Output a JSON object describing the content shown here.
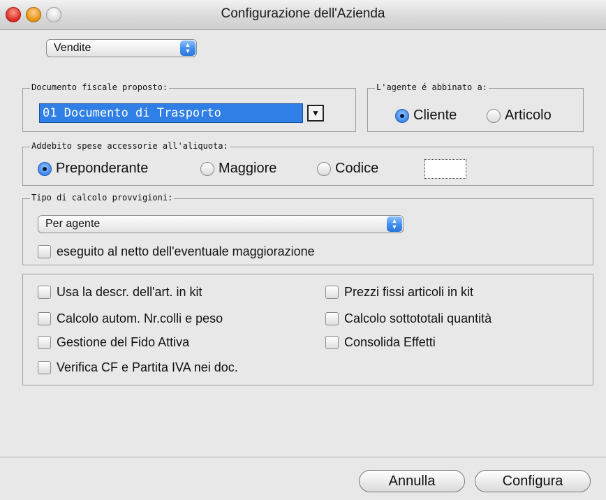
{
  "window": {
    "title": "Configurazione dell'Azienda"
  },
  "section_popup": {
    "value": "Vendite"
  },
  "documento": {
    "label": "Documento fiscale proposto:",
    "value": "01 Documento di Trasporto",
    "button_glyph": "▼"
  },
  "agente": {
    "label": "L'agente é abbinato a:",
    "options": [
      "Cliente",
      "Articolo"
    ],
    "selected": "Cliente"
  },
  "addebito": {
    "label": "Addebito spese accessorie all'aliquota:",
    "options": [
      "Preponderante",
      "Maggiore",
      "Codice"
    ],
    "selected": "Preponderante",
    "code_value": ""
  },
  "provvigioni": {
    "label": "Tipo di calcolo provvigioni:",
    "popup_value": "Per agente",
    "checkbox_label": "eseguito al netto dell'eventuale maggiorazione"
  },
  "options": {
    "left": [
      "Usa la descr. dell'art. in kit",
      "Calcolo autom. Nr.colli e peso",
      "Gestione del Fido Attiva",
      "Verifica CF e Partita IVA nei doc."
    ],
    "right": [
      "Prezzi fissi articoli in kit",
      "Calcolo sottototali quantità",
      "Consolida Effetti"
    ]
  },
  "buttons": {
    "cancel": "Annulla",
    "configure": "Configura"
  },
  "colors": {
    "selection": "#2f7fe6",
    "accent": "#3a86ee"
  }
}
